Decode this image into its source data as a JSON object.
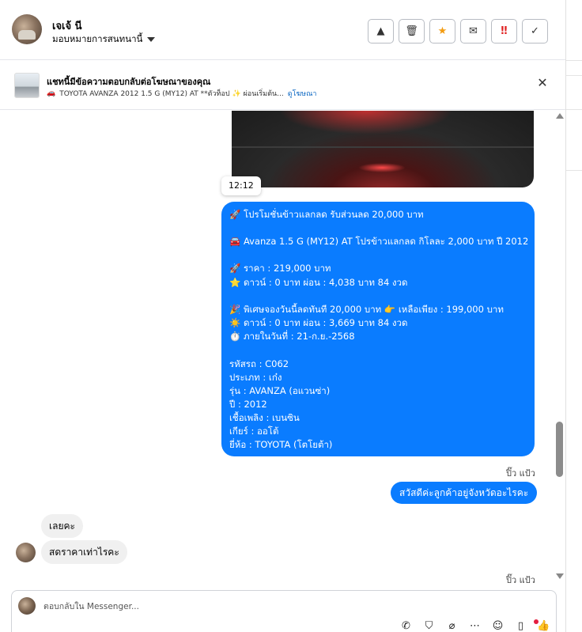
{
  "header": {
    "name": "เจเจ้ นี",
    "assign_label": "มอบหมายการสนทนานี้",
    "actions": [
      {
        "icon": "alert-triangle-icon",
        "glyph": "▲"
      },
      {
        "icon": "trash-icon",
        "glyph": "🗑"
      },
      {
        "icon": "star-icon",
        "glyph": "★"
      },
      {
        "icon": "mail-icon",
        "glyph": "✉"
      },
      {
        "icon": "urgent-icon",
        "glyph": "‼"
      },
      {
        "icon": "check-icon",
        "glyph": "✓"
      }
    ]
  },
  "banner": {
    "title": "แชทนี้มีข้อความตอบกลับต่อโฆษณาของคุณ",
    "car_glyph": "🚗",
    "subtitle": "TOYOTA AVANZA 2012 1.5 G (MY12) AT **ตัวท็อป ✨ ผ่อนเริ่มต้น...",
    "link": "ดูโฆษณา",
    "close_glyph": "✕"
  },
  "chat": {
    "timestamp": "12:12",
    "big_message": [
      "🚀 โปรโมชั่นข้าวแลกลด รับส่วนลด 20,000 บาท",
      "",
      "🚘 Avanza 1.5 G (MY12) AT โปรข้าวแลกลด กิโลละ 2,000 บาท ปี 2012",
      "",
      "🚀 ราคา : 219,000 บาท",
      "⭐ ดาวน์ : 0 บาท ผ่อน : 4,038 บาท 84 งวด",
      "",
      "🎉 พิเศษจองวันนี้ลดทันที 20,000 บาท 👉 เหลือเพียง : 199,000 บาท",
      "☀️ ดาวน์ : 0 บาท ผ่อน : 3,669 บาท 84 งวด",
      "⏱️ ภายในวันที่ : 21-ก.ย.-2568",
      "",
      "   รหัสรถ : C062",
      "   ประเภท : เก๋ง",
      "   รุ่น : AVANZA (อแวนซ่า)",
      "   ปี : 2012",
      "   เชื้อเพลิง : เบนซิน",
      "   เกียร์ : ออโต้",
      "   ยี่ห้อ : TOYOTA (โตโยต้า)"
    ],
    "seen_1": "ปิ๊ว แป้ว",
    "outgoing": "สวัสดีค่ะลูกค้าอยู่จังหวัดอะไรคะ",
    "incoming_1": "เลยคะ",
    "incoming_2": "สดราคาเท่าไรคะ",
    "seen_2": "ปิ๊ว แป้ว"
  },
  "composer": {
    "placeholder": "ตอบกลับใน Messenger...",
    "icons": [
      {
        "name": "quick-reply-icon",
        "glyph": "✆"
      },
      {
        "name": "shopping-bag-icon",
        "glyph": "⛉"
      },
      {
        "name": "attachment-icon",
        "glyph": "⌀"
      },
      {
        "name": "more-icon",
        "glyph": "⋯"
      },
      {
        "name": "emoji-icon",
        "glyph": "☺"
      },
      {
        "name": "notes-icon",
        "glyph": "▯"
      },
      {
        "name": "like-icon",
        "glyph": "👍"
      }
    ]
  },
  "colors": {
    "bubble_blue": "#0a7cff",
    "link_blue": "#0a66c2",
    "star_orange": "#f39c12",
    "urgent_red": "#e02020"
  }
}
